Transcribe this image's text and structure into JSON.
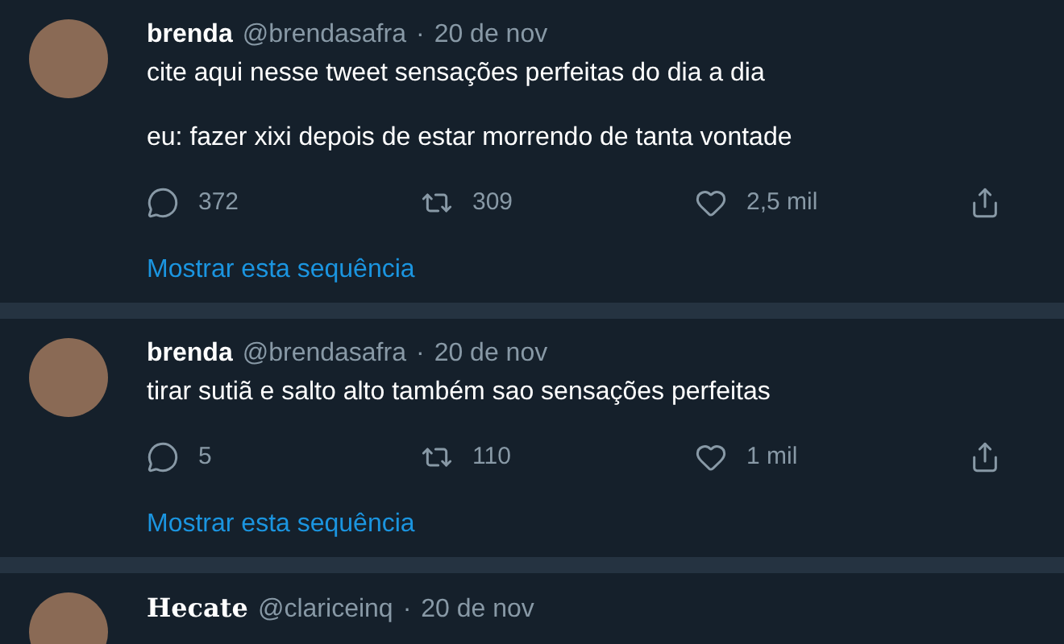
{
  "tweets": [
    {
      "name": "brenda",
      "handle": "@brendasafra",
      "separator": "·",
      "date": "20 de nov",
      "paragraphs": [
        "cite aqui nesse tweet sensações perfeitas do dia a dia",
        "eu: fazer xixi depois de estar morrendo de tanta vontade"
      ],
      "replies": "372",
      "retweets": "309",
      "likes": "2,5 mil",
      "thread_link": "Mostrar esta sequência"
    },
    {
      "name": "brenda",
      "handle": "@brendasafra",
      "separator": "·",
      "date": "20 de nov",
      "paragraphs": [
        "tirar sutiã e salto alto também sao sensações perfeitas"
      ],
      "replies": "5",
      "retweets": "110",
      "likes": "1 mil",
      "thread_link": "Mostrar esta sequência"
    },
    {
      "name": "Hecate",
      "handle": "@clariceinq",
      "separator": "·",
      "date": "20 de nov"
    }
  ]
}
